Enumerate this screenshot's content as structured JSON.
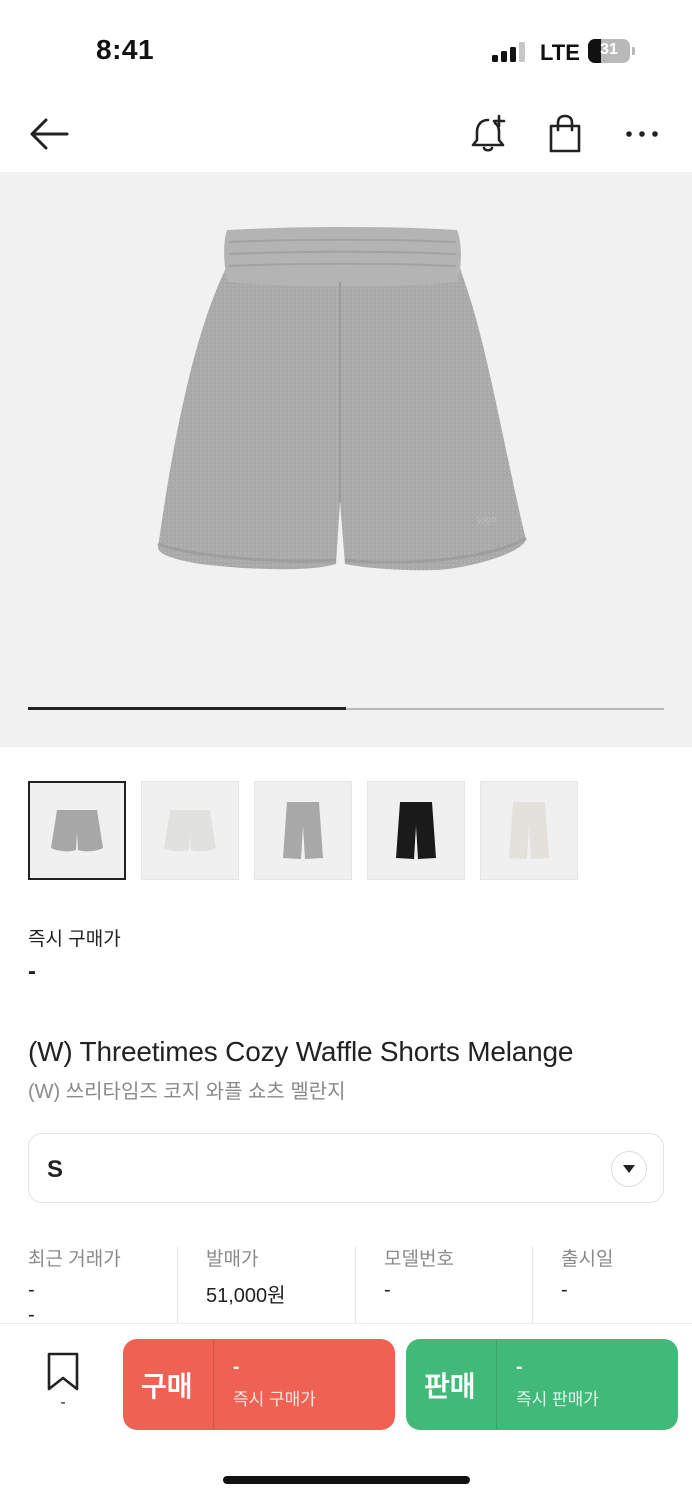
{
  "status": {
    "time": "8:41",
    "network": "LTE",
    "battery": "31",
    "battery_fraction": 0.31
  },
  "nav": {
    "back_icon": "arrow-left-icon",
    "alert_icon": "bell-plus-icon",
    "bag_icon": "shopping-bag-icon",
    "more_icon": "more-horizontal-icon"
  },
  "gallery": {
    "progress": 0.5,
    "thumbnails": [
      {
        "name": "grey-shorts",
        "color": "#a7a7a7",
        "selected": true
      },
      {
        "name": "white-shorts",
        "color": "#e1e1df",
        "selected": false
      },
      {
        "name": "grey-long-shorts",
        "color": "#a8a8a8",
        "selected": false
      },
      {
        "name": "black-long-shorts",
        "color": "#1a1a1a",
        "selected": false
      },
      {
        "name": "ivory-long-shorts",
        "color": "#e4e1dc",
        "selected": false
      }
    ]
  },
  "price": {
    "label": "즉시 구매가",
    "value": "-"
  },
  "product": {
    "name_en": "(W) Threetimes Cozy Waffle Shorts Melange",
    "name_ko": "(W) 쓰리타임즈 코지 와플 쇼츠 멜란지"
  },
  "size": {
    "selected": "S",
    "chevron_icon": "chevron-down-icon"
  },
  "info": {
    "recent_label": "최근 거래가",
    "recent_value": "-",
    "recent_change": "-",
    "release_price_label": "발매가",
    "release_price_value": "51,000원",
    "model_label": "모델번호",
    "model_value": "-",
    "release_date_label": "출시일",
    "release_date_value": "-"
  },
  "bottom": {
    "bookmark_icon": "bookmark-icon",
    "bookmark_count": "-",
    "buy_label": "구매",
    "buy_price": "-",
    "buy_sub": "즉시 구매가",
    "sell_label": "판매",
    "sell_price": "-",
    "sell_sub": "즉시 판매가",
    "colors": {
      "buy": "#ef6253",
      "sell": "#41b979"
    }
  }
}
